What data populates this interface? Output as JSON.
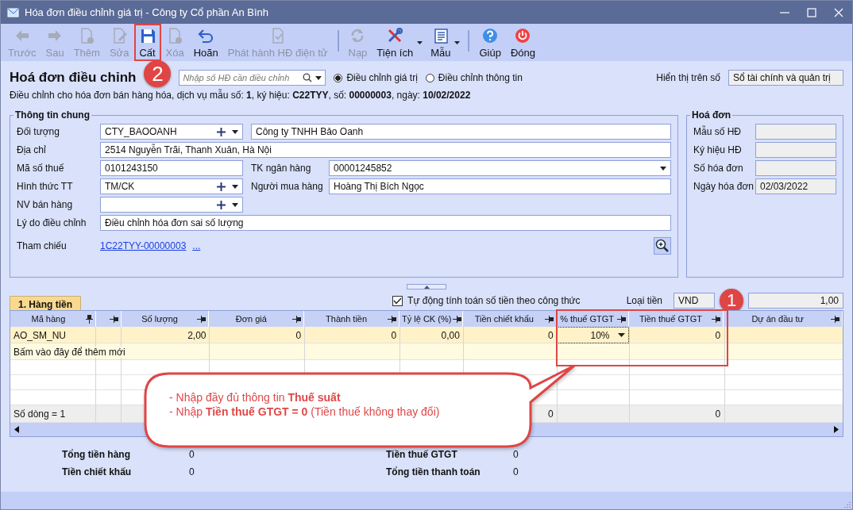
{
  "window": {
    "title": "Hóa đơn điều chỉnh giá trị - Công ty Cổ phần An Bình"
  },
  "toolbar": [
    {
      "label": "Trước",
      "disabled": true,
      "dropdown": false,
      "highlighted": false
    },
    {
      "label": "Sau",
      "disabled": true,
      "dropdown": false,
      "highlighted": false
    },
    {
      "label": "Thêm",
      "disabled": true,
      "dropdown": false,
      "highlighted": false
    },
    {
      "label": "Sửa",
      "disabled": true,
      "dropdown": false,
      "highlighted": false
    },
    {
      "label": "Cất",
      "disabled": false,
      "dropdown": false,
      "highlighted": true
    },
    {
      "label": "Xóa",
      "disabled": true,
      "dropdown": false,
      "highlighted": false
    },
    {
      "label": "Hoãn",
      "disabled": false,
      "dropdown": false,
      "highlighted": false
    },
    {
      "label": "Phát hành HĐ điện tử",
      "disabled": true,
      "dropdown": false,
      "highlighted": false
    },
    {
      "label": "Nạp",
      "disabled": true,
      "dropdown": false,
      "highlighted": false
    },
    {
      "label": "Tiện ích",
      "disabled": false,
      "dropdown": true,
      "highlighted": false
    },
    {
      "label": "Mẫu",
      "disabled": false,
      "dropdown": true,
      "highlighted": false
    },
    {
      "label": "Giúp",
      "disabled": false,
      "dropdown": false,
      "highlighted": false
    },
    {
      "label": "Đóng",
      "disabled": false,
      "dropdown": false,
      "highlighted": false
    }
  ],
  "header": {
    "title": "Hoá đơn điều chỉnh",
    "search": {
      "placeholder": "Nhập số HĐ cần điều chỉnh"
    },
    "radios": [
      {
        "label": "Điều chỉnh giá trị",
        "selected": true
      },
      {
        "label": "Điều chỉnh thông tin",
        "selected": false
      }
    ],
    "book": {
      "label": "Hiển thị trên số",
      "value": "Sổ tài chính và quản trị"
    },
    "subtitle": "Điều chỉnh cho hóa đơn bán hàng hóa, dịch vụ mẫu số: **1**, ký hiệu: **C22TYY**, số: **00000003**, ngày: **10/02/2022**"
  },
  "general": {
    "title": "Thông tin chung",
    "rows": [
      [
        {
          "label": "Đối tượng",
          "value": "CTY_BAOOANH",
          "kind": "combo"
        },
        {
          "value": "Công ty TNHH Bảo Oanh",
          "kind": "text"
        }
      ],
      [
        {
          "label": "Địa chỉ",
          "value": "2514 Nguyễn Trãi, Thanh Xuân, Hà Nội",
          "kind": "text"
        }
      ],
      [
        {
          "label": "Mã số thuế",
          "value": "0101243150",
          "kind": "text"
        },
        {
          "label": "TK ngân hàng",
          "value": "00001245852",
          "kind": "select"
        }
      ],
      [
        {
          "label": "Hình thức TT",
          "value": "TM/CK",
          "kind": "combo"
        },
        {
          "label": "Người mua hàng",
          "value": "Hoàng Thị Bích Ngọc",
          "kind": "text"
        }
      ],
      [
        {
          "label": "NV bán hàng",
          "kind": "combo"
        }
      ],
      [
        {
          "label": "Lý do điều chỉnh",
          "value": "Điều chỉnh hóa đơn sai số lượng",
          "kind": "text"
        }
      ]
    ],
    "reference": {
      "label": "Tham chiếu",
      "link": "1C22TYY-00000003",
      "more": "..."
    }
  },
  "invoice": {
    "title": "Hoá đơn",
    "fields": [
      {
        "label": "Mẫu số HĐ"
      },
      {
        "label": "Ký hiệu HĐ"
      },
      {
        "label": "Số hóa đơn"
      },
      {
        "label": "Ngày hóa đơn",
        "value": "02/03/2022"
      }
    ]
  },
  "grid": {
    "tab": {
      "label": "1. Hàng tiền",
      "selected": true
    },
    "auto_calc": {
      "label": "Tự động tính toán số tiền theo công thức",
      "checked": true
    },
    "currency": {
      "label": "Loại tiền",
      "value": "VND"
    },
    "rate": "1,00",
    "columns": [
      {
        "label": "Mã hàng",
        "pinned": true
      },
      {
        "pinned": false
      },
      {
        "label": "Số lượng",
        "pinned": false
      },
      {
        "label": "Đơn giá",
        "pinned": false
      },
      {
        "label": "Thành tiền",
        "pinned": false
      },
      {
        "label": "Tỷ lệ CK (%)",
        "pinned": false
      },
      {
        "label": "Tiền chiết khấu",
        "pinned": false
      },
      {
        "label": "% thuế GTGT",
        "pinned": false
      },
      {
        "label": "Tiền thuế GTGT",
        "pinned": false
      },
      {
        "label": "Dự án đầu tư",
        "pinned": false
      }
    ],
    "rows": [
      {
        "selected": true,
        "cells": [
          {
            "value": "AO_SM_NU",
            "focused": false
          },
          {
            "focused": false
          },
          {
            "value": "2,00",
            "focused": false
          },
          {
            "value": "0",
            "focused": false
          },
          {
            "value": "0",
            "focused": false
          },
          {
            "value": "0,00",
            "focused": false
          },
          {
            "value": "0",
            "focused": false
          },
          {
            "value": "10%",
            "focused": true
          },
          {
            "value": "0",
            "focused": false
          },
          {
            "focused": false
          }
        ]
      }
    ],
    "new_row_hint": "Bấm vào đây để thêm mới",
    "footer": {
      "row_count": "Số dòng = 1",
      "discount_total": "0",
      "vat_total": "0"
    }
  },
  "totals": [
    {
      "label": "Tổng tiền hàng",
      "value": "0"
    },
    {
      "label": "Tiền chiết khấu",
      "value": "0"
    },
    {
      "label": "Tiền thuế GTGT",
      "value": "0"
    },
    {
      "label": "Tổng tiền thanh toán",
      "value": "0"
    }
  ],
  "annotations": {
    "badges": [
      {
        "text": "1"
      },
      {
        "text": "2"
      }
    ],
    "callout": [
      "- Nhập đầy đủ thông tin **Thuế suất**",
      "- Nhập **Tiền thuế GTGT = 0** (Tiền thuế không thay đổi)"
    ]
  }
}
